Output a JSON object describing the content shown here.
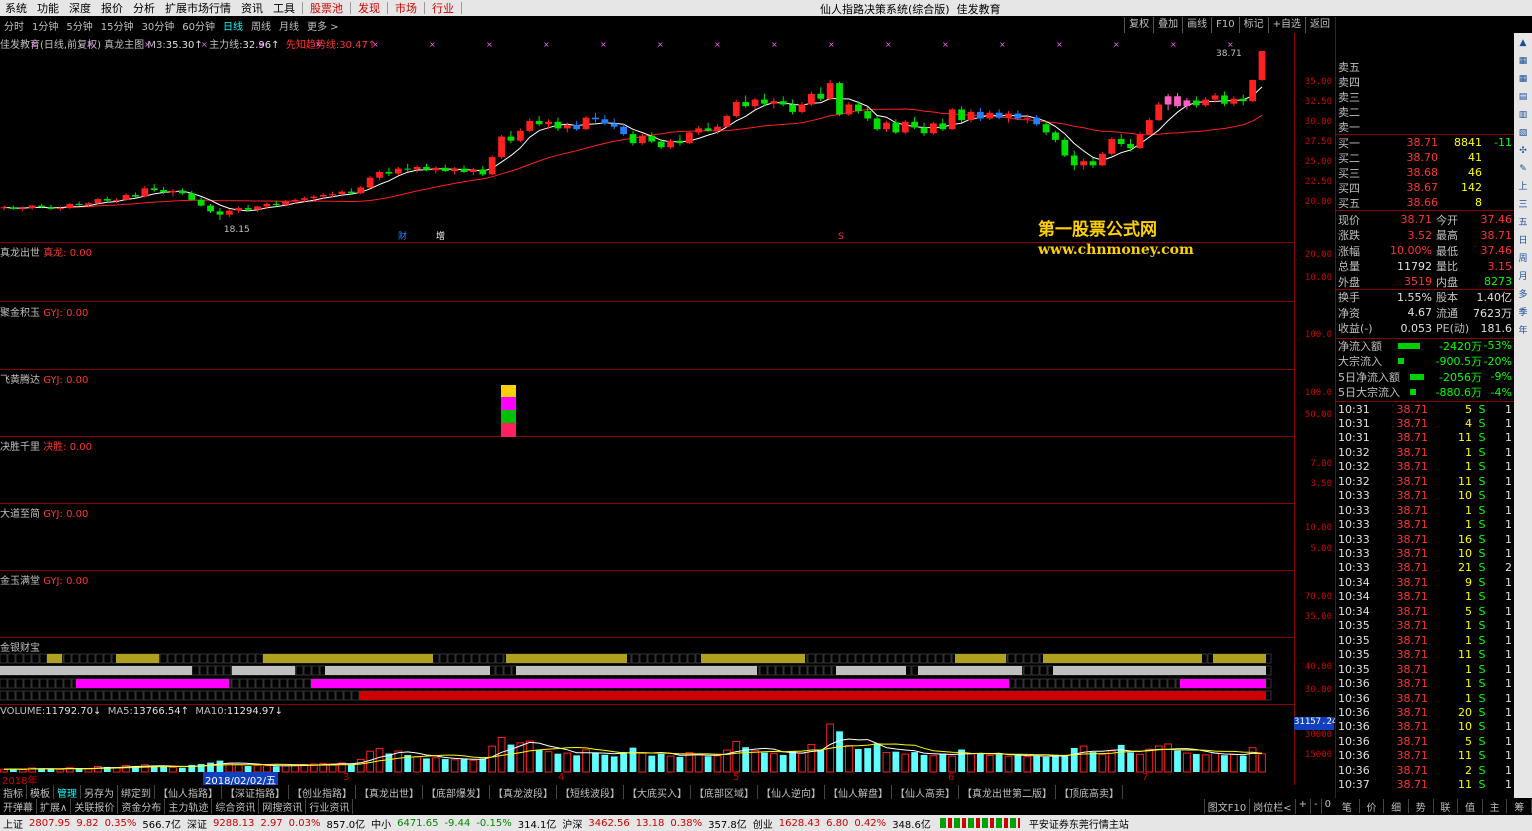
{
  "menu": {
    "items": [
      "系统",
      "功能",
      "深度",
      "报价",
      "分析",
      "扩展市场行情",
      "资讯",
      "工具"
    ],
    "highlight_items": [
      "股票池",
      "发现",
      "市场",
      "行业"
    ],
    "window_title": "仙人指路决策系统(综合版)",
    "window_subtitle": "佳发教育"
  },
  "periods": {
    "items": [
      "分时",
      "1分钟",
      "5分钟",
      "15分钟",
      "30分钟",
      "60分钟",
      "日线",
      "周线",
      "月线",
      "更多 >"
    ],
    "active": "日线",
    "right_buttons": [
      "复权",
      "叠加",
      "画线",
      "F10",
      "标记",
      "+自选",
      "返回"
    ]
  },
  "main_panel": {
    "name": "佳发教育(日线,前复权)",
    "indicator": "真龙主图",
    "m3_label": "M3:",
    "m3_value": "35.30↑",
    "zl_label": "主力线:",
    "zl_value": "32.96↑",
    "xz_label": "先知趋势线:",
    "xz_value": "30.47↑",
    "price_high_label": "38.71",
    "price_low_label": "18.15",
    "marker_cai": "财",
    "marker_zeng": "增",
    "marker_s": "S",
    "y_ticks": [
      "35.00",
      "32.50",
      "30.00",
      "27.50",
      "25.00",
      "22.50",
      "20.00"
    ]
  },
  "watermark": {
    "line1": "第一股票公式网",
    "line2": "www.chnmoney.com"
  },
  "sub_panels": [
    {
      "name": "真龙出世",
      "key": "真龙:",
      "value": "0.00",
      "ticks": [
        "20.00",
        "10.00"
      ]
    },
    {
      "name": "聚金积玉",
      "key": "GYJ:",
      "value": "0.00",
      "ticks": [
        "100.0"
      ]
    },
    {
      "name": "飞黄腾达",
      "key": "GYJ:",
      "value": "0.00",
      "ticks": [
        "100.0",
        "50.00"
      ]
    },
    {
      "name": "决胜千里",
      "key": "决胜:",
      "value": "0.00",
      "ticks": [
        "7.00",
        "3.50"
      ]
    },
    {
      "name": "大道至简",
      "key": "GYJ:",
      "value": "0.00",
      "ticks": [
        "10.00",
        "5.00"
      ]
    },
    {
      "name": "金玉满堂",
      "key": "GYJ:",
      "value": "0.00",
      "ticks": [
        "70.00",
        "35.00"
      ]
    },
    {
      "name": "金银财宝",
      "key": "",
      "value": "",
      "ticks": [
        "40.00",
        "30.00"
      ]
    }
  ],
  "volume_panel": {
    "label": "VOLUME:",
    "volume": "11792.70↓",
    "ma5_label": "MA5:",
    "ma5": "13766.54↑",
    "ma10_label": "MA10:",
    "ma10": "11294.97↓",
    "top_value": "31157.24",
    "ticks": [
      "30000",
      "15000"
    ],
    "date_labels": [
      "2018年",
      "2018/02/02/五",
      "3",
      "4",
      "5",
      "6",
      "7"
    ]
  },
  "quote": {
    "sell": [
      {
        "label": "卖五",
        "price": "",
        "vol": ""
      },
      {
        "label": "卖四",
        "price": "",
        "vol": ""
      },
      {
        "label": "卖三",
        "price": "",
        "vol": ""
      },
      {
        "label": "卖二",
        "price": "",
        "vol": ""
      },
      {
        "label": "卖一",
        "price": "",
        "vol": ""
      }
    ],
    "buy": [
      {
        "label": "买一",
        "price": "38.71",
        "vol": "8841",
        "chg": "-11"
      },
      {
        "label": "买二",
        "price": "38.70",
        "vol": "41",
        "chg": ""
      },
      {
        "label": "买三",
        "price": "38.68",
        "vol": "46",
        "chg": ""
      },
      {
        "label": "买四",
        "price": "38.67",
        "vol": "142",
        "chg": ""
      },
      {
        "label": "买五",
        "price": "38.66",
        "vol": "8",
        "chg": ""
      }
    ],
    "stats": [
      {
        "l1": "现价",
        "v1": "38.71",
        "l2": "今开",
        "v2": "37.46"
      },
      {
        "l1": "涨跌",
        "v1": "3.52",
        "l2": "最高",
        "v2": "38.71"
      },
      {
        "l1": "涨幅",
        "v1": "10.00%",
        "l2": "最低",
        "v2": "37.46"
      },
      {
        "l1": "总量",
        "v1": "11792",
        "l2": "量比",
        "v2": "3.15"
      },
      {
        "l1": "外盘",
        "v1": "3519",
        "l2": "内盘",
        "v2": "8273"
      },
      {
        "l1": "换手",
        "v1": "1.55%",
        "l2": "股本",
        "v2": "1.40亿"
      },
      {
        "l1": "净资",
        "v1": "4.67",
        "l2": "流通",
        "v2": "7623万"
      },
      {
        "l1": "收益(-)",
        "v1": "0.053",
        "l2": "PE(动)",
        "v2": "181.6"
      }
    ],
    "flows": [
      {
        "label": "净流入额",
        "value": "-2420万",
        "pct": "-53%"
      },
      {
        "label": "大宗流入",
        "value": "-900.5万",
        "pct": "-20%"
      },
      {
        "label": "5日净流入额",
        "value": "-2056万",
        "pct": "-9%"
      },
      {
        "label": "5日大宗流入",
        "value": "-880.6万",
        "pct": "-4%"
      }
    ],
    "ticks": [
      {
        "t": "10:31",
        "p": "38.71",
        "v": "5",
        "s": "S",
        "n": "1"
      },
      {
        "t": "10:31",
        "p": "38.71",
        "v": "4",
        "s": "S",
        "n": "1"
      },
      {
        "t": "10:31",
        "p": "38.71",
        "v": "11",
        "s": "S",
        "n": "1"
      },
      {
        "t": "10:32",
        "p": "38.71",
        "v": "1",
        "s": "S",
        "n": "1"
      },
      {
        "t": "10:32",
        "p": "38.71",
        "v": "1",
        "s": "S",
        "n": "1"
      },
      {
        "t": "10:32",
        "p": "38.71",
        "v": "11",
        "s": "S",
        "n": "1"
      },
      {
        "t": "10:33",
        "p": "38.71",
        "v": "10",
        "s": "S",
        "n": "1"
      },
      {
        "t": "10:33",
        "p": "38.71",
        "v": "1",
        "s": "S",
        "n": "1"
      },
      {
        "t": "10:33",
        "p": "38.71",
        "v": "1",
        "s": "S",
        "n": "1"
      },
      {
        "t": "10:33",
        "p": "38.71",
        "v": "16",
        "s": "S",
        "n": "1"
      },
      {
        "t": "10:33",
        "p": "38.71",
        "v": "10",
        "s": "S",
        "n": "1"
      },
      {
        "t": "10:33",
        "p": "38.71",
        "v": "21",
        "s": "S",
        "n": "2"
      },
      {
        "t": "10:34",
        "p": "38.71",
        "v": "9",
        "s": "S",
        "n": "1"
      },
      {
        "t": "10:34",
        "p": "38.71",
        "v": "1",
        "s": "S",
        "n": "1"
      },
      {
        "t": "10:34",
        "p": "38.71",
        "v": "5",
        "s": "S",
        "n": "1"
      },
      {
        "t": "10:35",
        "p": "38.71",
        "v": "1",
        "s": "S",
        "n": "1"
      },
      {
        "t": "10:35",
        "p": "38.71",
        "v": "1",
        "s": "S",
        "n": "1"
      },
      {
        "t": "10:35",
        "p": "38.71",
        "v": "11",
        "s": "S",
        "n": "1"
      },
      {
        "t": "10:35",
        "p": "38.71",
        "v": "1",
        "s": "S",
        "n": "1"
      },
      {
        "t": "10:36",
        "p": "38.71",
        "v": "1",
        "s": "S",
        "n": "1"
      },
      {
        "t": "10:36",
        "p": "38.71",
        "v": "1",
        "s": "S",
        "n": "1"
      },
      {
        "t": "10:36",
        "p": "38.71",
        "v": "20",
        "s": "S",
        "n": "1"
      },
      {
        "t": "10:36",
        "p": "38.71",
        "v": "10",
        "s": "S",
        "n": "1"
      },
      {
        "t": "10:36",
        "p": "38.71",
        "v": "5",
        "s": "S",
        "n": "1"
      },
      {
        "t": "10:36",
        "p": "38.71",
        "v": "11",
        "s": "S",
        "n": "1"
      },
      {
        "t": "10:36",
        "p": "38.71",
        "v": "2",
        "s": "S",
        "n": "1"
      },
      {
        "t": "10:37",
        "p": "38.71",
        "v": "11",
        "s": "S",
        "n": "1"
      }
    ]
  },
  "right_tools": [
    "上",
    "三",
    "五",
    "日",
    "周",
    "月",
    "多",
    "季",
    "年"
  ],
  "tabbar1": [
    "指标",
    "模板",
    "管理",
    "另存为",
    "绑定到",
    "【仙人指路】",
    "【深证指路】",
    "【创业指路】",
    "【真龙出世】",
    "【底部爆发】",
    "【真龙波段】",
    "【短线波段】",
    "【大底买入】",
    "【底部区域】",
    "【仙人逆向】",
    "【仙人解盘】",
    "【仙人高卖】",
    "【真龙出世第二版】",
    "【顶底高卖】"
  ],
  "tabbar1_active": "管理",
  "tabbar2": [
    "开弹幕",
    "扩展∧",
    "关联报价",
    "资金分布",
    "主力轨迹",
    "综合资讯",
    "网搜资讯",
    "行业资讯"
  ],
  "tabbar2_right": [
    "图文F10",
    "岗位栏<",
    "+",
    "-",
    "0"
  ],
  "infotabs": [
    "笔",
    "价",
    "细",
    "势",
    "联",
    "值",
    "主",
    "筹"
  ],
  "statusbar": [
    {
      "label": "上证",
      "value": "2807.95",
      "chg": "9.82",
      "pct": "0.35%",
      "amt": "566.7亿"
    },
    {
      "label": "深证",
      "value": "9288.13",
      "chg": "2.97",
      "pct": "0.03%",
      "amt": "857.0亿"
    },
    {
      "label": "中小",
      "value": "6471.65",
      "chg": "-9.44",
      "pct": "-0.15%",
      "amt": "314.1亿"
    },
    {
      "label": "沪深",
      "value": "3462.56",
      "chg": "13.18",
      "pct": "0.38%",
      "amt": "357.8亿"
    },
    {
      "label": "创业",
      "value": "1628.43",
      "chg": "6.80",
      "pct": "0.42%",
      "amt": "348.6亿"
    }
  ],
  "status_broker": "平安证券东莞行情主站",
  "colors": {
    "up": "#ff2020",
    "down": "#00e000",
    "panel_border": "#8b0000",
    "ma_white": "#ffffff",
    "ma_red": "#ff2020",
    "blue_candle": "#2080ff",
    "pink_candle": "#ff60c0",
    "volume_bar": "#60ffff"
  },
  "ohlc": [
    [
      19.6,
      19.9,
      19.3,
      19.7
    ],
    [
      19.7,
      19.9,
      19.4,
      19.5
    ],
    [
      19.5,
      19.8,
      19.2,
      19.6
    ],
    [
      19.6,
      20.0,
      19.4,
      19.9
    ],
    [
      19.9,
      20.1,
      19.6,
      19.7
    ],
    [
      19.7,
      20.0,
      19.4,
      19.5
    ],
    [
      19.5,
      19.8,
      19.3,
      19.6
    ],
    [
      19.6,
      20.2,
      19.5,
      20.1
    ],
    [
      20.1,
      20.4,
      19.9,
      20.0
    ],
    [
      20.0,
      20.3,
      19.7,
      20.2
    ],
    [
      20.2,
      20.8,
      20.1,
      20.7
    ],
    [
      20.7,
      21.0,
      20.3,
      20.5
    ],
    [
      20.5,
      20.8,
      20.2,
      20.6
    ],
    [
      20.6,
      21.4,
      20.5,
      21.2
    ],
    [
      21.2,
      21.5,
      20.8,
      21.0
    ],
    [
      21.0,
      22.3,
      20.9,
      22.0
    ],
    [
      22.0,
      22.5,
      21.6,
      21.8
    ],
    [
      21.8,
      22.2,
      21.3,
      21.5
    ],
    [
      21.5,
      21.9,
      21.0,
      21.7
    ],
    [
      21.7,
      22.0,
      21.2,
      21.4
    ],
    [
      21.4,
      21.7,
      20.5,
      20.6
    ],
    [
      20.6,
      20.9,
      19.8,
      19.9
    ],
    [
      19.9,
      20.1,
      19.0,
      19.2
    ],
    [
      19.2,
      19.6,
      18.15,
      18.8
    ],
    [
      18.8,
      19.5,
      18.5,
      19.3
    ],
    [
      19.3,
      19.8,
      19.0,
      19.6
    ],
    [
      19.6,
      20.0,
      19.2,
      19.4
    ],
    [
      19.4,
      19.9,
      19.1,
      19.8
    ],
    [
      19.8,
      20.3,
      19.5,
      20.1
    ],
    [
      20.1,
      20.5,
      19.8,
      20.0
    ],
    [
      20.0,
      20.6,
      19.8,
      20.4
    ],
    [
      20.4,
      20.8,
      20.1,
      20.6
    ],
    [
      20.6,
      21.0,
      20.3,
      20.8
    ],
    [
      20.8,
      21.2,
      20.5,
      21.0
    ],
    [
      21.0,
      21.4,
      20.7,
      21.2
    ],
    [
      21.2,
      21.6,
      20.9,
      21.3
    ],
    [
      21.3,
      21.8,
      21.0,
      21.6
    ],
    [
      21.6,
      22.0,
      21.2,
      21.4
    ],
    [
      21.4,
      22.3,
      21.3,
      22.1
    ],
    [
      22.1,
      23.5,
      22.0,
      23.3
    ],
    [
      23.3,
      24.2,
      23.0,
      24.0
    ],
    [
      24.0,
      24.5,
      23.5,
      23.8
    ],
    [
      23.8,
      24.6,
      23.6,
      24.4
    ],
    [
      24.4,
      25.0,
      24.0,
      24.3
    ],
    [
      24.3,
      24.8,
      23.9,
      24.6
    ],
    [
      24.6,
      25.0,
      24.1,
      24.2
    ],
    [
      24.2,
      24.7,
      23.8,
      24.5
    ],
    [
      24.5,
      24.9,
      24.0,
      24.1
    ],
    [
      24.1,
      24.6,
      23.7,
      24.4
    ],
    [
      24.4,
      24.8,
      23.9,
      24.0
    ],
    [
      24.0,
      24.5,
      23.6,
      24.3
    ],
    [
      24.3,
      24.7,
      23.5,
      23.7
    ],
    [
      23.7,
      26.0,
      23.6,
      25.8
    ],
    [
      25.8,
      28.5,
      25.6,
      28.3
    ],
    [
      28.3,
      29.0,
      27.5,
      27.8
    ],
    [
      27.8,
      29.3,
      27.6,
      29.0
    ],
    [
      29.0,
      30.5,
      28.8,
      30.2
    ],
    [
      30.2,
      30.8,
      29.6,
      29.8
    ],
    [
      29.8,
      30.4,
      29.2,
      30.1
    ],
    [
      30.1,
      30.6,
      29.0,
      29.3
    ],
    [
      29.3,
      30.0,
      28.8,
      29.7
    ],
    [
      29.7,
      30.2,
      29.0,
      29.2
    ],
    [
      29.2,
      30.8,
      29.1,
      30.6
    ],
    [
      30.6,
      31.2,
      30.0,
      30.4
    ],
    [
      30.4,
      30.9,
      29.7,
      29.9
    ],
    [
      29.9,
      30.5,
      29.2,
      29.5
    ],
    [
      29.5,
      29.9,
      28.4,
      28.6
    ],
    [
      28.6,
      29.0,
      27.2,
      27.5
    ],
    [
      27.5,
      28.6,
      27.3,
      28.4
    ],
    [
      28.4,
      28.8,
      27.5,
      27.7
    ],
    [
      27.7,
      28.0,
      26.8,
      27.0
    ],
    [
      27.0,
      28.0,
      26.8,
      27.8
    ],
    [
      27.8,
      28.5,
      27.2,
      27.5
    ],
    [
      27.5,
      29.0,
      27.4,
      28.8
    ],
    [
      28.8,
      29.6,
      28.5,
      29.3
    ],
    [
      29.3,
      30.0,
      28.9,
      29.0
    ],
    [
      29.0,
      29.8,
      28.6,
      29.5
    ],
    [
      29.5,
      31.0,
      29.4,
      30.8
    ],
    [
      30.8,
      32.8,
      30.6,
      32.5
    ],
    [
      32.5,
      33.3,
      31.8,
      32.0
    ],
    [
      32.0,
      33.0,
      31.6,
      32.8
    ],
    [
      32.8,
      33.5,
      32.0,
      32.3
    ],
    [
      32.3,
      33.0,
      31.7,
      32.6
    ],
    [
      32.6,
      33.2,
      32.0,
      32.2
    ],
    [
      32.2,
      32.8,
      31.0,
      31.3
    ],
    [
      31.3,
      32.5,
      31.1,
      32.2
    ],
    [
      32.2,
      33.8,
      32.0,
      33.5
    ],
    [
      33.5,
      34.3,
      32.6,
      32.9
    ],
    [
      32.9,
      35.2,
      32.7,
      34.8
    ],
    [
      34.8,
      35.0,
      30.8,
      31.0
    ],
    [
      31.0,
      32.5,
      30.8,
      32.2
    ],
    [
      32.2,
      32.6,
      31.1,
      31.4
    ],
    [
      31.4,
      31.9,
      30.2,
      30.5
    ],
    [
      30.5,
      30.8,
      29.0,
      29.2
    ],
    [
      29.2,
      30.2,
      28.9,
      30.0
    ],
    [
      30.0,
      30.4,
      28.6,
      28.8
    ],
    [
      28.8,
      30.3,
      28.6,
      30.1
    ],
    [
      30.1,
      30.7,
      29.2,
      29.4
    ],
    [
      29.4,
      30.0,
      28.4,
      28.7
    ],
    [
      28.7,
      30.1,
      28.5,
      29.9
    ],
    [
      29.9,
      30.5,
      29.0,
      29.2
    ],
    [
      29.2,
      31.8,
      29.1,
      31.6
    ],
    [
      31.6,
      32.0,
      30.0,
      30.3
    ],
    [
      30.3,
      31.6,
      30.1,
      31.3
    ],
    [
      31.3,
      31.8,
      30.2,
      30.5
    ],
    [
      30.5,
      31.5,
      30.3,
      31.2
    ],
    [
      31.2,
      31.6,
      30.4,
      30.6
    ],
    [
      30.6,
      31.4,
      30.0,
      31.1
    ],
    [
      31.1,
      31.5,
      30.3,
      30.5
    ],
    [
      30.5,
      31.0,
      29.9,
      30.6
    ],
    [
      30.6,
      30.9,
      29.6,
      29.8
    ],
    [
      29.8,
      30.2,
      28.5,
      28.8
    ],
    [
      28.8,
      29.0,
      27.6,
      27.9
    ],
    [
      27.9,
      28.2,
      25.8,
      26.0
    ],
    [
      26.0,
      26.6,
      24.2,
      24.8
    ],
    [
      24.8,
      25.6,
      24.3,
      25.3
    ],
    [
      25.3,
      25.7,
      24.5,
      24.8
    ],
    [
      24.8,
      26.4,
      24.7,
      26.2
    ],
    [
      26.2,
      28.2,
      26.0,
      28.0
    ],
    [
      28.0,
      28.6,
      27.1,
      27.4
    ],
    [
      27.4,
      28.0,
      26.5,
      26.9
    ],
    [
      26.9,
      28.9,
      26.8,
      28.6
    ],
    [
      28.6,
      30.6,
      28.5,
      30.3
    ],
    [
      30.3,
      32.5,
      30.2,
      32.2
    ],
    [
      32.2,
      33.5,
      31.5,
      33.2
    ],
    [
      33.2,
      33.6,
      31.8,
      32.0
    ],
    [
      32.0,
      33.0,
      31.6,
      32.7
    ],
    [
      32.7,
      33.2,
      31.8,
      32.1
    ],
    [
      32.1,
      33.1,
      31.9,
      32.8
    ],
    [
      32.8,
      33.6,
      32.4,
      33.3
    ],
    [
      33.3,
      33.8,
      32.0,
      32.3
    ],
    [
      32.3,
      33.2,
      32.0,
      32.9
    ],
    [
      32.9,
      33.4,
      32.1,
      32.6
    ],
    [
      32.6,
      35.2,
      32.5,
      35.19
    ],
    [
      35.19,
      38.71,
      35.1,
      38.71
    ]
  ],
  "volumes": [
    1800,
    2100,
    1600,
    2600,
    2300,
    2000,
    1700,
    2800,
    2400,
    2200,
    3600,
    3300,
    2900,
    4200,
    3800,
    4700,
    4100,
    3500,
    3000,
    2800,
    4600,
    5200,
    6100,
    7400,
    5600,
    4800,
    3900,
    4300,
    4100,
    3700,
    4000,
    4400,
    4800,
    5200,
    5600,
    5200,
    5900,
    5000,
    8200,
    13500,
    15200,
    12000,
    13600,
    11000,
    9800,
    8800,
    9200,
    8400,
    7900,
    8300,
    7600,
    8800,
    16800,
    22400,
    17800,
    18900,
    20100,
    14600,
    13200,
    11900,
    12300,
    10800,
    14400,
    12700,
    11200,
    10100,
    13000,
    15800,
    12200,
    10600,
    11700,
    10300,
    9800,
    12600,
    11400,
    10200,
    10500,
    14200,
    19800,
    16100,
    13800,
    12600,
    11900,
    11100,
    13500,
    12200,
    17900,
    14500,
    31157,
    26400,
    17200,
    14900,
    15500,
    18600,
    12600,
    13200,
    11600,
    12900,
    11100,
    10600,
    11900,
    10300,
    14600,
    11800,
    12300,
    10700,
    11400,
    10200,
    11000,
    9900,
    10300,
    9700,
    11200,
    10800,
    15600,
    16800,
    12900,
    11300,
    13700,
    17600,
    12700,
    11500,
    14800,
    16900,
    18200,
    13900,
    12300,
    11700,
    11100,
    12400,
    10900,
    11300,
    10600,
    15800,
    11793
  ]
}
